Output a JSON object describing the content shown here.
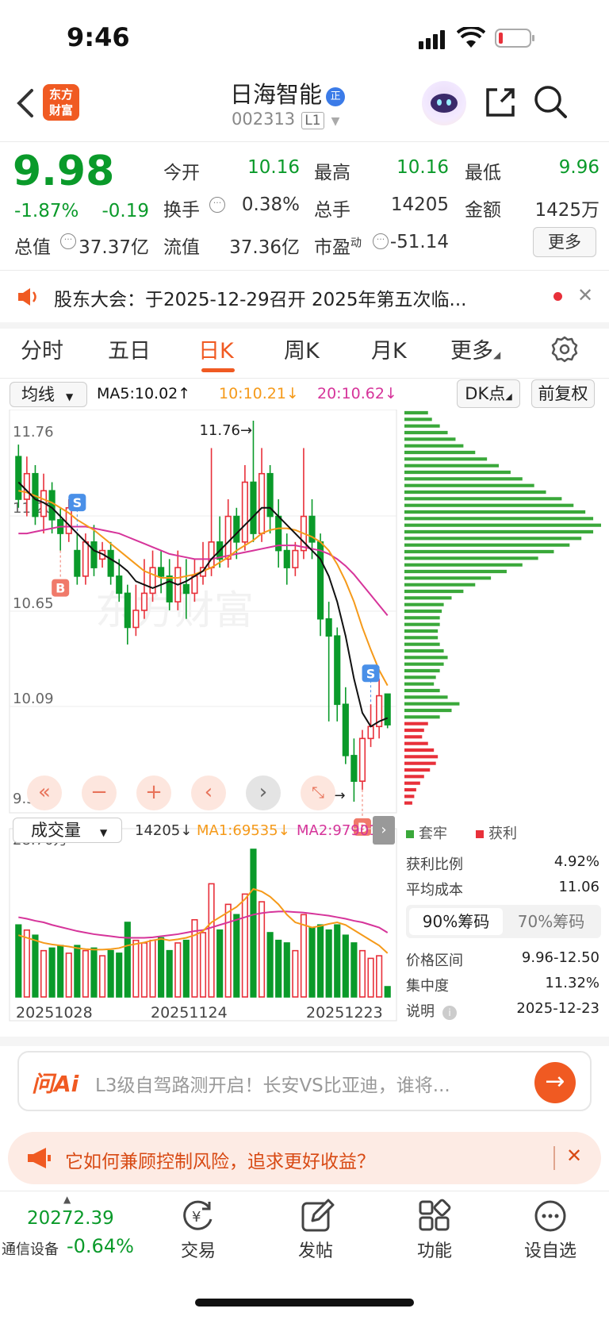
{
  "status_bar": {
    "time": "9:46"
  },
  "header": {
    "logo_text": "东方\n财富",
    "stock_name": "日海智能",
    "badge": "正",
    "stock_code": "002313",
    "level": "L1"
  },
  "quote": {
    "price": "9.98",
    "change_pct": "-1.87%",
    "change": "-0.19",
    "fields": [
      {
        "label": "今开",
        "value": "10.16"
      },
      {
        "label": "最高",
        "value": "10.16"
      },
      {
        "label": "最低",
        "value": "9.96"
      },
      {
        "label": "换手",
        "value": "0.38%"
      },
      {
        "label": "总手",
        "value": "14205"
      },
      {
        "label": "金额",
        "value": "1425万"
      },
      {
        "label": "总值",
        "value": "37.37亿"
      },
      {
        "label": "流值",
        "value": "37.36亿"
      },
      {
        "label": "市盈",
        "sup": "动",
        "value": "-51.14"
      }
    ],
    "more_button": "更多"
  },
  "notice": {
    "text": "股东大会：于2025-12-29召开 2025年第五次临..."
  },
  "tabs": [
    "分时",
    "五日",
    "日K",
    "周K",
    "月K",
    "更多"
  ],
  "active_tab": "日K",
  "chart_toolbar": {
    "indicator_select": "均线",
    "ma5": "MA5:10.02",
    "ma10": "10:10.21",
    "ma20": "20:10.62",
    "dk_button": "DK点",
    "adjust_button": "前复权"
  },
  "colors": {
    "up": "#e8303a",
    "down": "#0a9a2a",
    "ma5": "#111111",
    "ma10": "#f59a1a",
    "ma20": "#d6349a",
    "accent": "#ff5a1f"
  },
  "chart_data": {
    "type": "candlestick",
    "y_labels": [
      "11.76",
      "11.20",
      "10.65",
      "10.09",
      "9.53"
    ],
    "ylim": [
      9.53,
      11.76
    ],
    "high_marker": "11.76→",
    "low_marker": "9.53→",
    "volume_max_label": "28.70万",
    "volume_legend": {
      "select": "成交量",
      "vol": "14205",
      "ma1": "MA1:69535",
      "ma2": "MA2:97901"
    },
    "x_labels": [
      "20251028",
      "20251124",
      "20251223"
    ],
    "candles": [
      {
        "o": 11.55,
        "c": 11.3,
        "h": 11.62,
        "l": 11.25,
        "v": 14.0
      },
      {
        "o": 11.3,
        "c": 11.45,
        "h": 11.55,
        "l": 11.2,
        "v": 13.0
      },
      {
        "o": 11.45,
        "c": 11.2,
        "h": 11.5,
        "l": 11.15,
        "v": 12.0
      },
      {
        "o": 11.2,
        "c": 11.35,
        "h": 11.45,
        "l": 11.1,
        "v": 9.0
      },
      {
        "o": 11.35,
        "c": 11.18,
        "h": 11.4,
        "l": 11.1,
        "v": 9.5
      },
      {
        "o": 11.18,
        "c": 11.1,
        "h": 11.25,
        "l": 11.0,
        "v": 10.0
      },
      {
        "o": 11.1,
        "c": 11.25,
        "h": 11.3,
        "l": 11.05,
        "v": 8.5
      },
      {
        "o": 11.0,
        "c": 10.85,
        "h": 11.1,
        "l": 10.8,
        "v": 10.0
      },
      {
        "o": 10.85,
        "c": 11.05,
        "h": 11.1,
        "l": 10.8,
        "v": 9.0
      },
      {
        "o": 11.05,
        "c": 10.9,
        "h": 11.15,
        "l": 10.85,
        "v": 9.5
      },
      {
        "o": 10.95,
        "c": 11.0,
        "h": 11.05,
        "l": 10.9,
        "v": 8.0
      },
      {
        "o": 11.0,
        "c": 10.85,
        "h": 11.05,
        "l": 10.8,
        "v": 9.0
      },
      {
        "o": 10.85,
        "c": 10.75,
        "h": 10.95,
        "l": 10.7,
        "v": 8.5
      },
      {
        "o": 10.75,
        "c": 10.55,
        "h": 10.8,
        "l": 10.45,
        "v": 14.5
      },
      {
        "o": 10.55,
        "c": 10.65,
        "h": 10.8,
        "l": 10.5,
        "v": 11.0
      },
      {
        "o": 10.65,
        "c": 10.75,
        "h": 10.95,
        "l": 10.6,
        "v": 10.5
      },
      {
        "o": 10.75,
        "c": 10.9,
        "h": 11.0,
        "l": 10.7,
        "v": 11.0
      },
      {
        "o": 10.9,
        "c": 10.85,
        "h": 11.0,
        "l": 10.75,
        "v": 11.5
      },
      {
        "o": 10.85,
        "c": 10.7,
        "h": 10.95,
        "l": 10.65,
        "v": 9.0
      },
      {
        "o": 10.7,
        "c": 10.9,
        "h": 11.0,
        "l": 10.65,
        "v": 10.5
      },
      {
        "o": 10.8,
        "c": 10.75,
        "h": 10.95,
        "l": 10.6,
        "v": 11.0
      },
      {
        "o": 10.75,
        "c": 10.85,
        "h": 10.95,
        "l": 10.7,
        "v": 15.0
      },
      {
        "o": 10.85,
        "c": 10.9,
        "h": 11.05,
        "l": 10.8,
        "v": 12.5
      },
      {
        "o": 10.9,
        "c": 11.05,
        "h": 11.6,
        "l": 10.85,
        "v": 22.0
      },
      {
        "o": 11.05,
        "c": 10.95,
        "h": 11.2,
        "l": 10.9,
        "v": 13.0
      },
      {
        "o": 10.95,
        "c": 11.2,
        "h": 11.3,
        "l": 10.9,
        "v": 18.0
      },
      {
        "o": 11.2,
        "c": 11.05,
        "h": 11.25,
        "l": 10.95,
        "v": 16.0
      },
      {
        "o": 11.05,
        "c": 11.4,
        "h": 11.5,
        "l": 11.0,
        "v": 20.0
      },
      {
        "o": 11.4,
        "c": 11.1,
        "h": 11.76,
        "l": 11.05,
        "v": 28.7
      },
      {
        "o": 11.1,
        "c": 11.45,
        "h": 11.6,
        "l": 11.05,
        "v": 18.5
      },
      {
        "o": 11.45,
        "c": 11.2,
        "h": 11.5,
        "l": 11.1,
        "v": 12.5
      },
      {
        "o": 11.2,
        "c": 11.0,
        "h": 11.3,
        "l": 10.9,
        "v": 11.0
      },
      {
        "o": 11.0,
        "c": 10.9,
        "h": 11.1,
        "l": 10.8,
        "v": 10.5
      },
      {
        "o": 10.9,
        "c": 11.0,
        "h": 11.05,
        "l": 10.85,
        "v": 9.0
      },
      {
        "o": 11.0,
        "c": 11.2,
        "h": 11.6,
        "l": 10.95,
        "v": 16.0
      },
      {
        "o": 11.2,
        "c": 11.05,
        "h": 11.3,
        "l": 10.95,
        "v": 13.5
      },
      {
        "o": 11.05,
        "c": 10.6,
        "h": 11.1,
        "l": 10.5,
        "v": 14.0
      },
      {
        "o": 10.6,
        "c": 10.5,
        "h": 10.7,
        "l": 10.0,
        "v": 13.0
      },
      {
        "o": 10.5,
        "c": 10.1,
        "h": 10.55,
        "l": 10.0,
        "v": 14.0
      },
      {
        "o": 10.1,
        "c": 9.8,
        "h": 10.2,
        "l": 9.75,
        "v": 12.0
      },
      {
        "o": 9.8,
        "c": 9.65,
        "h": 9.9,
        "l": 9.53,
        "v": 10.5
      },
      {
        "o": 9.65,
        "c": 9.9,
        "h": 9.95,
        "l": 9.6,
        "v": 9.0
      },
      {
        "o": 9.9,
        "c": 9.97,
        "h": 10.1,
        "l": 9.85,
        "v": 7.5
      },
      {
        "o": 9.97,
        "c": 10.15,
        "h": 10.25,
        "l": 9.9,
        "v": 8.0
      },
      {
        "o": 10.16,
        "c": 9.98,
        "h": 10.16,
        "l": 9.96,
        "v": 2.0
      }
    ],
    "ma5": [
      11.4,
      11.35,
      11.3,
      11.28,
      11.25,
      11.2,
      11.15,
      11.1,
      11.05,
      11.0,
      10.98,
      10.95,
      10.92,
      10.88,
      10.82,
      10.8,
      10.78,
      10.8,
      10.82,
      10.8,
      10.82,
      10.85,
      10.88,
      10.95,
      11.0,
      11.05,
      11.1,
      11.15,
      11.2,
      11.25,
      11.25,
      11.2,
      11.15,
      11.1,
      11.05,
      11.0,
      10.95,
      10.85,
      10.7,
      10.5,
      10.25,
      10.05,
      9.97,
      10.0,
      10.02
    ],
    "ma10": [
      11.35,
      11.34,
      11.32,
      11.3,
      11.28,
      11.25,
      11.22,
      11.18,
      11.15,
      11.12,
      11.08,
      11.04,
      11.0,
      10.96,
      10.92,
      10.88,
      10.86,
      10.84,
      10.84,
      10.84,
      10.85,
      10.86,
      10.88,
      10.9,
      10.93,
      10.96,
      11.0,
      11.03,
      11.06,
      11.1,
      11.12,
      11.13,
      11.13,
      11.12,
      11.1,
      11.08,
      11.05,
      11.0,
      10.92,
      10.82,
      10.7,
      10.55,
      10.42,
      10.3,
      10.21
    ],
    "ma20": [
      11.1,
      11.1,
      11.11,
      11.12,
      11.13,
      11.14,
      11.14,
      11.14,
      11.14,
      11.13,
      11.12,
      11.11,
      11.1,
      11.08,
      11.06,
      11.04,
      11.02,
      11.0,
      10.98,
      10.97,
      10.96,
      10.95,
      10.95,
      10.95,
      10.96,
      10.97,
      10.98,
      10.99,
      11.0,
      11.01,
      11.02,
      11.03,
      11.03,
      11.03,
      11.02,
      11.01,
      11.0,
      10.98,
      10.95,
      10.91,
      10.86,
      10.8,
      10.74,
      10.68,
      10.62
    ],
    "vol_ma1": [
      12.0,
      11.5,
      11.0,
      10.5,
      10.2,
      10.0,
      9.8,
      9.5,
      9.3,
      9.2,
      9.2,
      9.3,
      9.5,
      10.0,
      10.3,
      10.6,
      11.0,
      11.3,
      11.0,
      11.2,
      11.5,
      12.0,
      12.8,
      14.5,
      15.5,
      16.5,
      17.5,
      19.0,
      21.0,
      20.5,
      19.5,
      18.0,
      16.0,
      14.5,
      14.0,
      13.5,
      13.8,
      14.2,
      14.5,
      14.0,
      13.0,
      12.0,
      11.0,
      10.0,
      8.5
    ],
    "vol_ma2": [
      15.5,
      15.2,
      14.8,
      14.5,
      14.0,
      13.6,
      13.2,
      12.8,
      12.5,
      12.2,
      12.0,
      11.8,
      11.6,
      11.5,
      11.5,
      11.5,
      11.6,
      11.8,
      12.0,
      12.2,
      12.5,
      12.8,
      13.0,
      13.5,
      14.0,
      14.5,
      15.0,
      15.5,
      16.0,
      16.3,
      16.5,
      16.6,
      16.6,
      16.5,
      16.4,
      16.2,
      16.0,
      15.8,
      15.5,
      15.2,
      14.8,
      14.5,
      14.0,
      13.5,
      12.5
    ],
    "signals": [
      {
        "type": "S",
        "index": 7
      },
      {
        "type": "B",
        "index": 5
      },
      {
        "type": "S",
        "index": 42
      },
      {
        "type": "B",
        "index": 41
      }
    ]
  },
  "chip": {
    "legend_locked": "套牢",
    "legend_profit": "获利",
    "profit_ratio_label": "获利比例",
    "profit_ratio": "4.92%",
    "avg_cost_label": "平均成本",
    "avg_cost": "11.06",
    "tab_90": "90%筹码",
    "tab_70": "70%筹码",
    "range_label": "价格区间",
    "range": "9.96-12.50",
    "concentration_label": "集中度",
    "concentration": "11.32%",
    "note_label": "说明",
    "date": "2025-12-23",
    "distribution": [
      0.12,
      0.14,
      0.18,
      0.22,
      0.26,
      0.3,
      0.36,
      0.42,
      0.48,
      0.54,
      0.6,
      0.66,
      0.72,
      0.8,
      0.86,
      0.92,
      0.96,
      1.0,
      0.96,
      0.9,
      0.84,
      0.76,
      0.68,
      0.6,
      0.52,
      0.44,
      0.36,
      0.3,
      0.24,
      0.2,
      0.19,
      0.18,
      0.18,
      0.17,
      0.17,
      0.18,
      0.2,
      0.22,
      0.2,
      0.18,
      0.16,
      0.15,
      0.18,
      0.22,
      0.28,
      0.24,
      0.18,
      0.12,
      0.1,
      0.09,
      0.12,
      0.15,
      0.17,
      0.16,
      0.13,
      0.1,
      0.08,
      0.06,
      0.05,
      0.04
    ]
  },
  "ai_bar": {
    "logo": "问Ai",
    "text": "L3级自驾路测开启！长安VS比亚迪，谁将..."
  },
  "promo": {
    "text": "它如何兼顾控制风险，追求更好收益？"
  },
  "bottom_nav": {
    "index_value": "20272.39",
    "index_name": "通信设备",
    "index_change": "-0.64%",
    "items": [
      "交易",
      "发帖",
      "功能",
      "设自选"
    ]
  }
}
